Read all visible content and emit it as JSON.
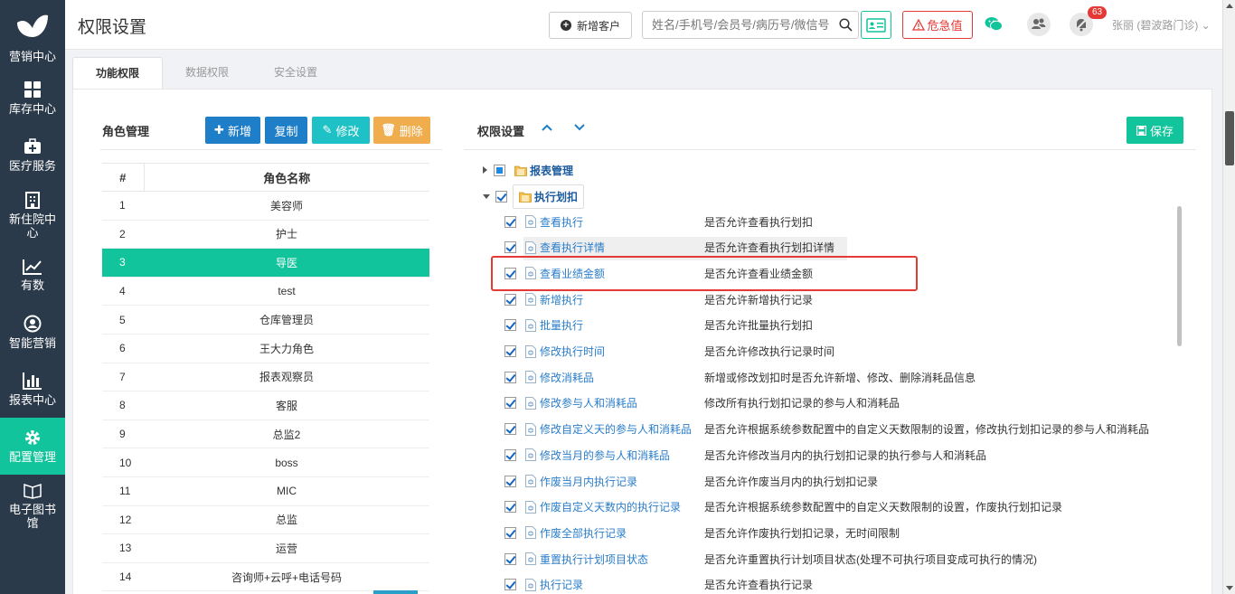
{
  "sidebar": {
    "items": [
      {
        "label": "营销中心",
        "icon": "butterfly-logo-icon"
      },
      {
        "label": "库存中心",
        "icon": "grid-icon"
      },
      {
        "label": "医疗服务",
        "icon": "medkit-icon"
      },
      {
        "label": "新住院中心",
        "icon": "hospital-icon"
      },
      {
        "label": "有数",
        "icon": "trend-chart-icon"
      },
      {
        "label": "智能营销",
        "icon": "smart-marketing-icon"
      },
      {
        "label": "报表中心",
        "icon": "bar-chart-icon"
      },
      {
        "label": "配置管理",
        "icon": "gear-icon"
      },
      {
        "label": "电子图书馆",
        "icon": "book-icon"
      }
    ],
    "active_index": 7
  },
  "header": {
    "title": "权限设置",
    "new_customer": "新增客户",
    "search_placeholder": "姓名/手机号/会员号/病历号/微信号",
    "danger_label": "危急值",
    "notification_count": "63",
    "user": "张丽 (碧波路门诊)"
  },
  "tabs": [
    {
      "label": "功能权限",
      "active": true
    },
    {
      "label": "数据权限",
      "active": false
    },
    {
      "label": "安全设置",
      "active": false
    }
  ],
  "roles": {
    "title": "角色管理",
    "buttons": {
      "add": "新增",
      "copy": "复制",
      "edit": "修改",
      "delete": "删除"
    },
    "col_num": "#",
    "col_name": "角色名称",
    "selected_index": 2,
    "rows": [
      {
        "num": "1",
        "name": "美容师"
      },
      {
        "num": "2",
        "name": "护士"
      },
      {
        "num": "3",
        "name": "导医"
      },
      {
        "num": "4",
        "name": "test"
      },
      {
        "num": "5",
        "name": "仓库管理员"
      },
      {
        "num": "6",
        "name": "王大力角色"
      },
      {
        "num": "7",
        "name": "报表观察员"
      },
      {
        "num": "8",
        "name": "客服"
      },
      {
        "num": "9",
        "name": "总监2"
      },
      {
        "num": "10",
        "name": "boss"
      },
      {
        "num": "11",
        "name": "MIC"
      },
      {
        "num": "12",
        "name": "总监"
      },
      {
        "num": "13",
        "name": "运营"
      },
      {
        "num": "14",
        "name": "咨询师+云呼+电话号码"
      }
    ]
  },
  "permissions": {
    "title": "权限设置",
    "save": "保存",
    "groups": [
      {
        "label": "报表管理",
        "state": "partial",
        "expanded": false
      },
      {
        "label": "执行划扣",
        "state": "checked",
        "expanded": true
      }
    ],
    "items": [
      {
        "name": "查看执行",
        "desc": "是否允许查看执行划扣"
      },
      {
        "name": "查看执行详情",
        "desc": "是否允许查看执行划扣详情"
      },
      {
        "name": "查看业绩金额",
        "desc": "是否允许查看业绩金额"
      },
      {
        "name": "新增执行",
        "desc": "是否允许新增执行记录"
      },
      {
        "name": "批量执行",
        "desc": "是否允许批量执行划扣"
      },
      {
        "name": "修改执行时间",
        "desc": "是否允许修改执行记录时间"
      },
      {
        "name": "修改消耗品",
        "desc": "新增或修改划扣时是否允许新增、修改、删除消耗品信息"
      },
      {
        "name": "修改参与人和消耗品",
        "desc": "修改所有执行划扣记录的参与人和消耗品"
      },
      {
        "name": "修改自定义天的参与人和消耗品",
        "desc": "是否允许根据系统参数配置中的自定义天数限制的设置，修改执行划扣记录的参与人和消耗品"
      },
      {
        "name": "修改当月的参与人和消耗品",
        "desc": "是否允许修改当月内的执行划扣记录的执行参与人和消耗品"
      },
      {
        "name": "作废当月内执行记录",
        "desc": "是否允许作废当月内的执行划扣记录"
      },
      {
        "name": "作废自定义天数内的执行记录",
        "desc": "是否允许根据系统参数配置中的自定义天数限制的设置，作废执行划扣记录"
      },
      {
        "name": "作废全部执行记录",
        "desc": "是否允许作废执行划扣记录，无时间限制"
      },
      {
        "name": "重置执行计划项目状态",
        "desc": "是否允许重置执行计划项目状态(处理不可执行项目变成可执行的情况)"
      },
      {
        "name": "执行记录",
        "desc": "是否允许查看执行记录"
      }
    ]
  },
  "colors": {
    "sidebar_bg": "#2b3a4a",
    "accent": "#12c49b",
    "blue_btn": "#1e7ec8",
    "cyan_btn": "#1ec1c5",
    "orange_btn": "#f0ad4e",
    "danger": "#e53935"
  }
}
